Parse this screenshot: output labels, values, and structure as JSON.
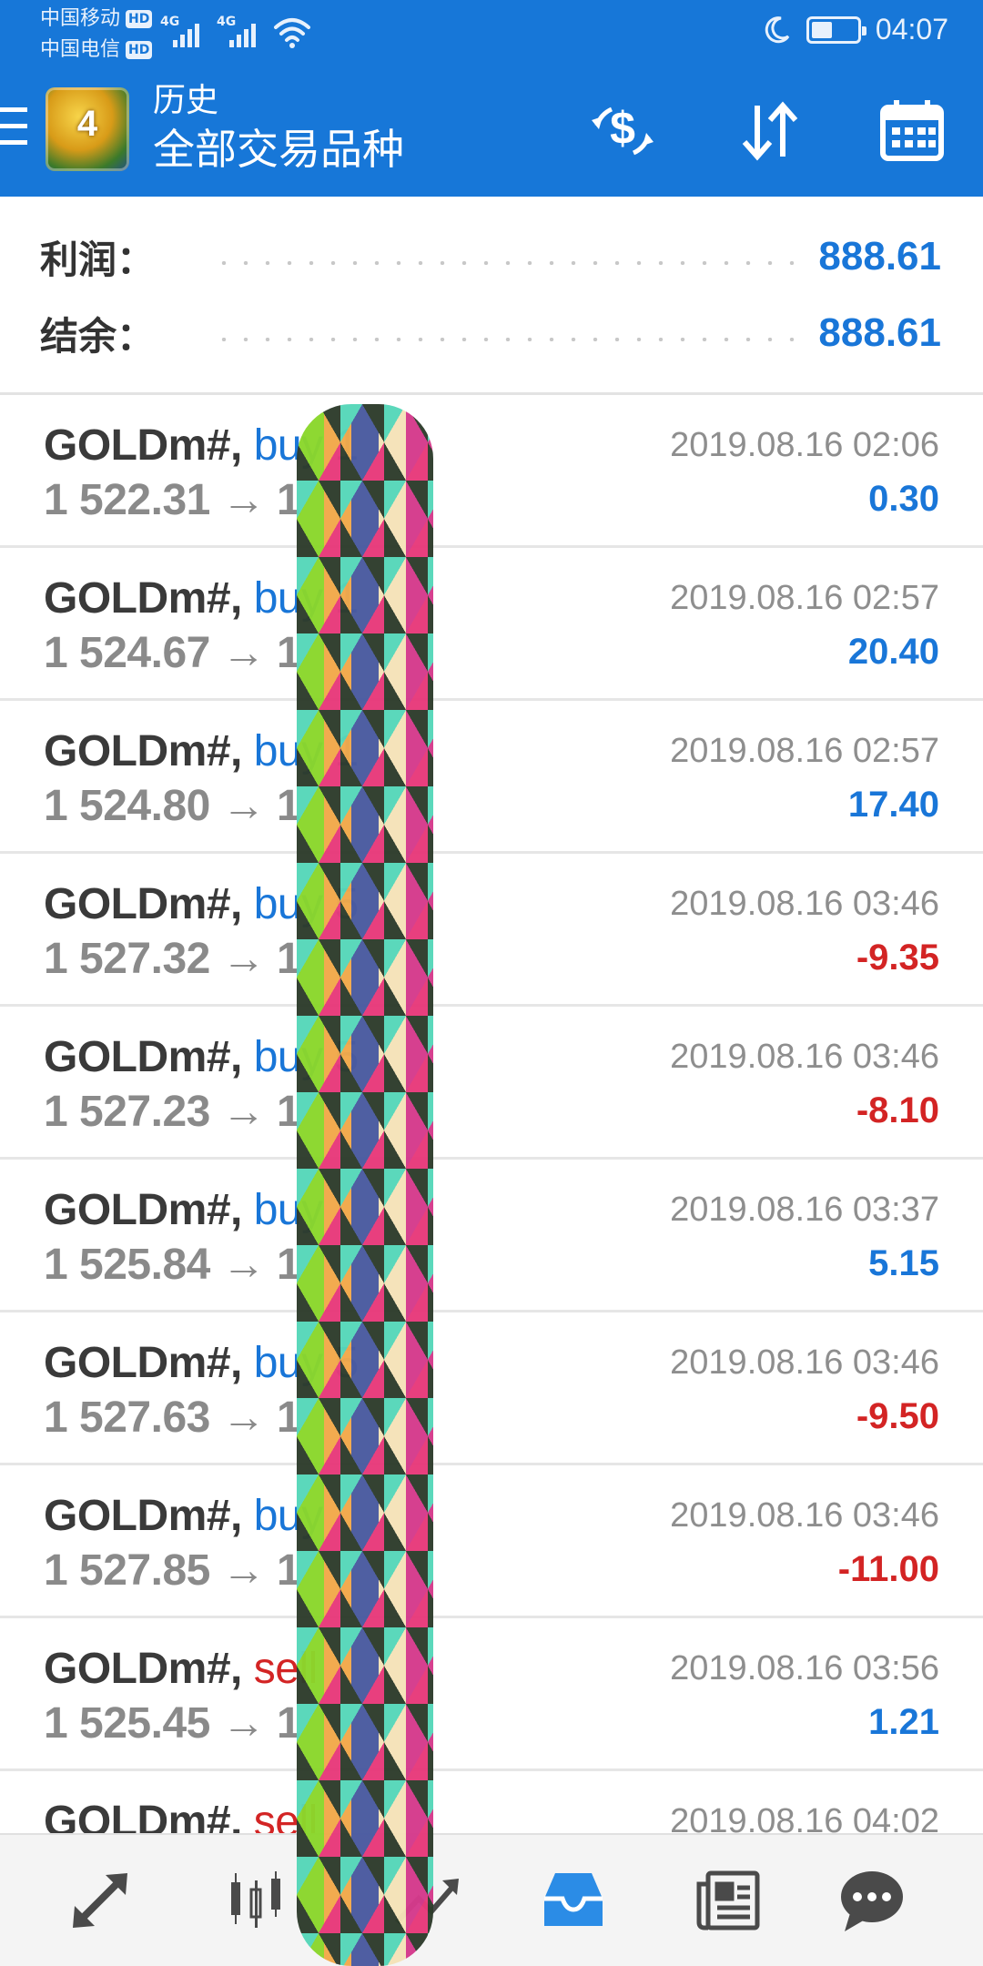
{
  "status_bar": {
    "carrier_1": "中国移动",
    "carrier_2": "中国电信",
    "hd_badge": "HD",
    "network_1": "4G",
    "network_2": "4G",
    "time": "04:07"
  },
  "app_bar": {
    "logo_digit": "4",
    "title_small": "历史",
    "title_big": "全部交易品种",
    "icons": [
      "currency-exchange-icon",
      "sort-icon",
      "calendar-icon"
    ]
  },
  "summary": {
    "profit_label": "利润：",
    "profit_value": "888.61",
    "balance_label": "结余：",
    "balance_value": "888.61"
  },
  "trades": [
    {
      "symbol": "GOLDm#,",
      "type": "buy",
      "type_label": "buy 1",
      "prices": "1 522.31 → 1 ",
      "time": "2019.08.16 02:06",
      "profit": "0.30",
      "sign": "pos"
    },
    {
      "symbol": "GOLDm#,",
      "type": "buy",
      "type_label": "buy 1",
      "prices": "1 524.67 → 1 ",
      "time": "2019.08.16 02:57",
      "profit": "20.40",
      "sign": "pos"
    },
    {
      "symbol": "GOLDm#,",
      "type": "buy",
      "type_label": "buy 1",
      "prices": "1 524.80 → 1 ",
      "time": "2019.08.16 02:57",
      "profit": "17.40",
      "sign": "pos"
    },
    {
      "symbol": "GOLDm#,",
      "type": "buy",
      "type_label": "buy 5",
      "prices": "1 527.32 → 1 ",
      "time": "2019.08.16 03:46",
      "profit": "-9.35",
      "sign": "neg"
    },
    {
      "symbol": "GOLDm#,",
      "type": "buy",
      "type_label": "buy 5",
      "prices": "1 527.23 → 1 ",
      "time": "2019.08.16 03:46",
      "profit": "-8.10",
      "sign": "neg"
    },
    {
      "symbol": "GOLDm#,",
      "type": "buy",
      "type_label": "buy",
      "prices": "1 525.84 → 1 ",
      "time": "2019.08.16 03:37",
      "profit": "5.15",
      "sign": "pos"
    },
    {
      "symbol": "GOLDm#,",
      "type": "buy",
      "type_label": "buy 5",
      "prices": "1 527.63 → 1 ",
      "time": "2019.08.16 03:46",
      "profit": "-9.50",
      "sign": "neg"
    },
    {
      "symbol": "GOLDm#,",
      "type": "buy",
      "type_label": "buy",
      "prices": "1 527.85 → 1 ",
      "time": "2019.08.16 03:46",
      "profit": "-11.00",
      "sign": "neg"
    },
    {
      "symbol": "GOLDm#,",
      "type": "sell",
      "type_label": "sell",
      "prices": "1 525.45 → 1 ",
      "time": "2019.08.16 03:56",
      "profit": "1.21",
      "sign": "pos"
    },
    {
      "symbol": "GOLDm#,",
      "type": "sell",
      "type_label": "sell",
      "prices": "",
      "time": "2019.08.16 04:02",
      "profit": "",
      "sign": "pos"
    }
  ],
  "bottom_nav": {
    "items": [
      "quotes-icon",
      "chart-icon",
      "trade-icon",
      "history-icon",
      "news-icon",
      "chat-icon"
    ],
    "active": "history-icon",
    "active_color": "#2b8ce6"
  },
  "colors": {
    "primary": "#1777d8",
    "positive": "#1976d8",
    "negative": "#d32424"
  }
}
